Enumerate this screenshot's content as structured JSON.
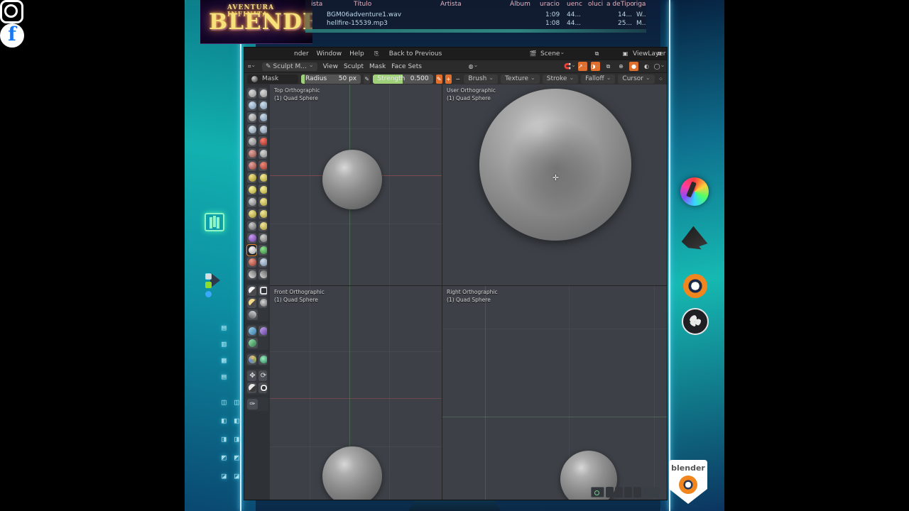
{
  "stream": {
    "logo": {
      "sub": "AVENTURA INFINITA",
      "main": "BLENDER"
    },
    "bottom_hud_label": "",
    "rail_icons": [
      {
        "name": "krita-icon",
        "label": "Krita"
      },
      {
        "name": "inkscape-icon",
        "label": "Inkscape"
      },
      {
        "name": "blender-icon",
        "label": "Blender"
      },
      {
        "name": "obs-icon",
        "label": "OBS Studio"
      },
      {
        "name": "instagram-icon",
        "label": "Instagram"
      },
      {
        "name": "facebook-icon",
        "label": "Facebook"
      }
    ],
    "badge": {
      "text": "blender"
    },
    "facebook_glyph": "f"
  },
  "media_player": {
    "columns": [
      "ista",
      "Título",
      "Artista",
      "Álbum",
      "uracio",
      "uenc",
      "oluci",
      "a de",
      "Tipo",
      "riga"
    ],
    "tracks": [
      {
        "title": "BGM06adventure1.wav",
        "duration": "1:09",
        "rate": "44...",
        "bits": "14...",
        "kind": "W..."
      },
      {
        "title": "hellfire-15539.mp3",
        "duration": "1:08",
        "rate": "44...",
        "bits": "25...",
        "kind": "M..."
      }
    ]
  },
  "blender": {
    "topbar": {
      "menus": [
        "nder",
        "Window",
        "Help"
      ],
      "back_button": "Back to Previous",
      "scene_label": "Scene",
      "viewlayer_label": "ViewLayer"
    },
    "header": {
      "mode": "Sculpt M...",
      "menus": [
        "View",
        "Sculpt",
        "Mask",
        "Face Sets"
      ]
    },
    "tool_settings": {
      "brush_name": "Mask",
      "radius_label": "Radius",
      "radius_value": "50 px",
      "radius_fill_pct": 6,
      "strength_label": "Strength",
      "strength_value": "0.500",
      "strength_fill_pct": 50,
      "dropdowns": [
        "Brush",
        "Texture",
        "Stroke",
        "Falloff",
        "Cursor"
      ]
    },
    "viewports": [
      {
        "name": "top-orthographic",
        "view": "Top Orthographic",
        "object": "(1) Quad Sphere"
      },
      {
        "name": "user-orthographic",
        "view": "User Orthographic",
        "object": "(1) Quad Sphere"
      },
      {
        "name": "front-orthographic",
        "view": "Front Orthographic",
        "object": "(1) Quad Sphere"
      },
      {
        "name": "right-orthographic",
        "view": "Right Orthographic",
        "object": "(1) Quad Sphere"
      }
    ],
    "colors": {
      "viewport_bg": "#3d4147",
      "panel_bg": "#2e3135",
      "header_bg": "#2b2b2b",
      "accent": "#e06f2e",
      "slider_fill": "#9fd07a"
    }
  }
}
